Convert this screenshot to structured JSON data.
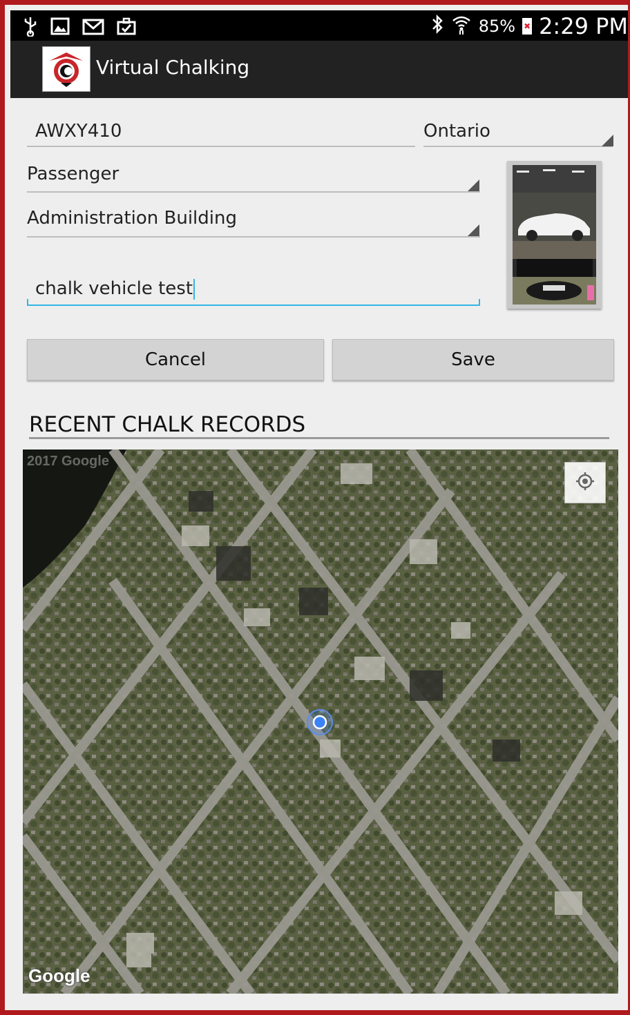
{
  "status_bar": {
    "battery_text": "85%",
    "time": "2:29 PM",
    "icons": [
      "usb-icon",
      "image-icon",
      "mail-icon",
      "briefcase-icon",
      "bluetooth-icon",
      "wifi-icon",
      "battery-icon"
    ]
  },
  "app": {
    "title": "Virtual Chalking",
    "icon": "app-logo-icon"
  },
  "form": {
    "plate_value": "AWXY410",
    "province_value": "Ontario",
    "vehicle_type_value": "Passenger",
    "location_value": "Administration Building",
    "note_value": "chalk vehicle test"
  },
  "buttons": {
    "cancel_label": "Cancel",
    "save_label": "Save"
  },
  "recent": {
    "title": "RECENT CHALK RECORDS"
  },
  "map": {
    "attribution": "Google",
    "watermark": "2017 Google",
    "locate_icon": "my-location-icon"
  },
  "colors": {
    "frame": "#b01a1e",
    "focus_line": "#33b5e5",
    "location_dot": "#3b82f6"
  }
}
